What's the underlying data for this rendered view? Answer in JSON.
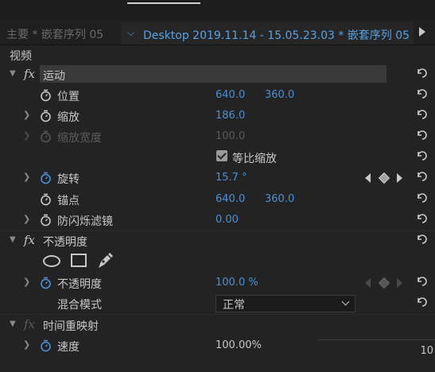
{
  "tabs": {
    "inactive": "主要 * 嵌套序列 05",
    "active": "Desktop 2019.11.14 - 15.05.23.03 * 嵌套序列 05"
  },
  "section_label": "视频",
  "motion": {
    "name": "运动",
    "position": {
      "label": "位置",
      "x": "640.0",
      "y": "360.0"
    },
    "scale": {
      "label": "缩放",
      "value": "186.0"
    },
    "scale_width": {
      "label": "缩放宽度",
      "value": "100.0"
    },
    "uniform_scale": {
      "label": "等比缩放",
      "checked": true
    },
    "rotation": {
      "label": "旋转",
      "value": "15.7 °"
    },
    "anchor": {
      "label": "锚点",
      "x": "640.0",
      "y": "360.0"
    },
    "antiflicker": {
      "label": "防闪烁滤镜",
      "value": "0.00"
    }
  },
  "opacity": {
    "name": "不透明度",
    "mask_tools": [
      "ellipse-mask-icon",
      "rectangle-mask-icon",
      "pen-mask-icon"
    ],
    "opacity": {
      "label": "不透明度",
      "value": "100.0 %"
    },
    "blend": {
      "label": "混合模式",
      "value": "正常"
    }
  },
  "time_remap": {
    "name": "时间重映射",
    "speed": {
      "label": "速度",
      "value": "100.00%"
    }
  },
  "corner_value": "10",
  "colors": {
    "accent": "#4a90d9",
    "panel": "#232323"
  }
}
